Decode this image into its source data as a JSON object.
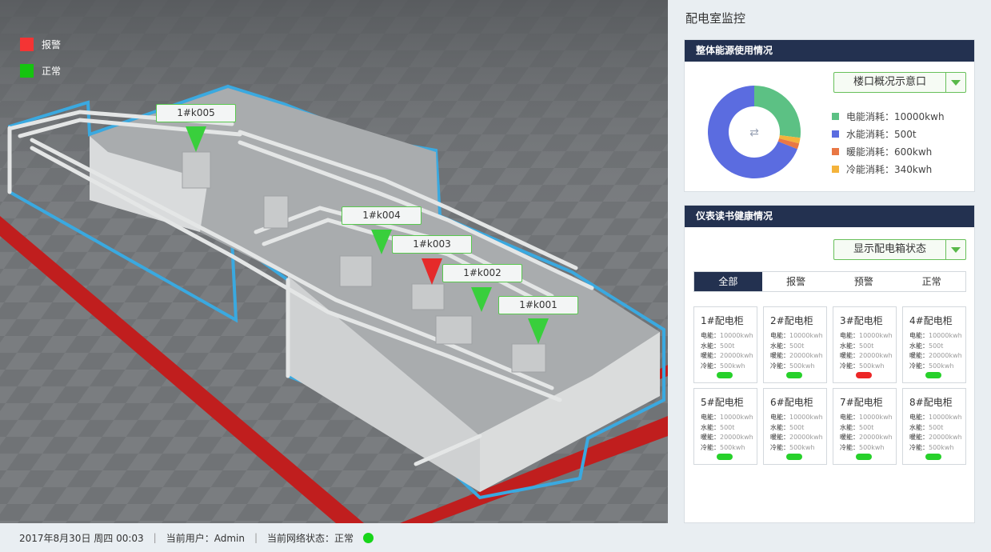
{
  "legend": [
    {
      "label": "报警",
      "color": "#f43434"
    },
    {
      "label": "正常",
      "color": "#15c40f"
    }
  ],
  "tags": [
    {
      "label": "1#k005",
      "status": "normal"
    },
    {
      "label": "1#k004",
      "status": "normal"
    },
    {
      "label": "1#k003",
      "status": "alarm"
    },
    {
      "label": "1#k002",
      "status": "normal"
    },
    {
      "label": "1#k001",
      "status": "normal"
    }
  ],
  "panel": {
    "title": "配电室监控",
    "energy": {
      "header": "整体能源使用情况",
      "select_label": "楼口概况示意口",
      "center_icon": "swap-arrows-icon",
      "items": [
        {
          "label": "电能消耗：10000kwh",
          "color": "#5cc184"
        },
        {
          "label": "水能消耗：500t",
          "color": "#5b6ce0"
        },
        {
          "label": "暖能消耗：600kwh",
          "color": "#e97744"
        },
        {
          "label": "冷能消耗：340kwh",
          "color": "#f4b33b"
        }
      ]
    },
    "meters": {
      "header": "仪表读书健康情况",
      "select_label": "显示配电箱状态",
      "tabs": [
        "全部",
        "报警",
        "预警",
        "正常"
      ],
      "active_tab": 0,
      "cabinets": [
        {
          "title": "1#配电柜",
          "elec": "10000kwh",
          "water": "500t",
          "heat": "20000kwh",
          "cold": "500kwh",
          "status": "#27d12b"
        },
        {
          "title": "2#配电柜",
          "elec": "10000kwh",
          "water": "500t",
          "heat": "20000kwh",
          "cold": "500kwh",
          "status": "#27d12b"
        },
        {
          "title": "3#配电柜",
          "elec": "10000kwh",
          "water": "500t",
          "heat": "20000kwh",
          "cold": "500kwh",
          "status": "#ec2727"
        },
        {
          "title": "4#配电柜",
          "elec": "10000kwh",
          "water": "500t",
          "heat": "20000kwh",
          "cold": "500kwh",
          "status": "#27d12b"
        },
        {
          "title": "5#配电柜",
          "elec": "10000kwh",
          "water": "500t",
          "heat": "20000kwh",
          "cold": "500kwh",
          "status": "#27d12b"
        },
        {
          "title": "6#配电柜",
          "elec": "10000kwh",
          "water": "500t",
          "heat": "20000kwh",
          "cold": "500kwh",
          "status": "#27d12b"
        },
        {
          "title": "7#配电柜",
          "elec": "10000kwh",
          "water": "500t",
          "heat": "20000kwh",
          "cold": "500kwh",
          "status": "#27d12b"
        },
        {
          "title": "8#配电柜",
          "elec": "10000kwh",
          "water": "500t",
          "heat": "20000kwh",
          "cold": "500kwh",
          "status": "#27d12b"
        }
      ],
      "line_labels": {
        "elec": "电能：",
        "water": "水能：",
        "heat": "暖能：",
        "cold": "冷能："
      }
    }
  },
  "footer": {
    "datetime": "2017年8月30日 周四 00:03",
    "user": "当前用户：Admin",
    "network": "当前网络状态：正常"
  }
}
